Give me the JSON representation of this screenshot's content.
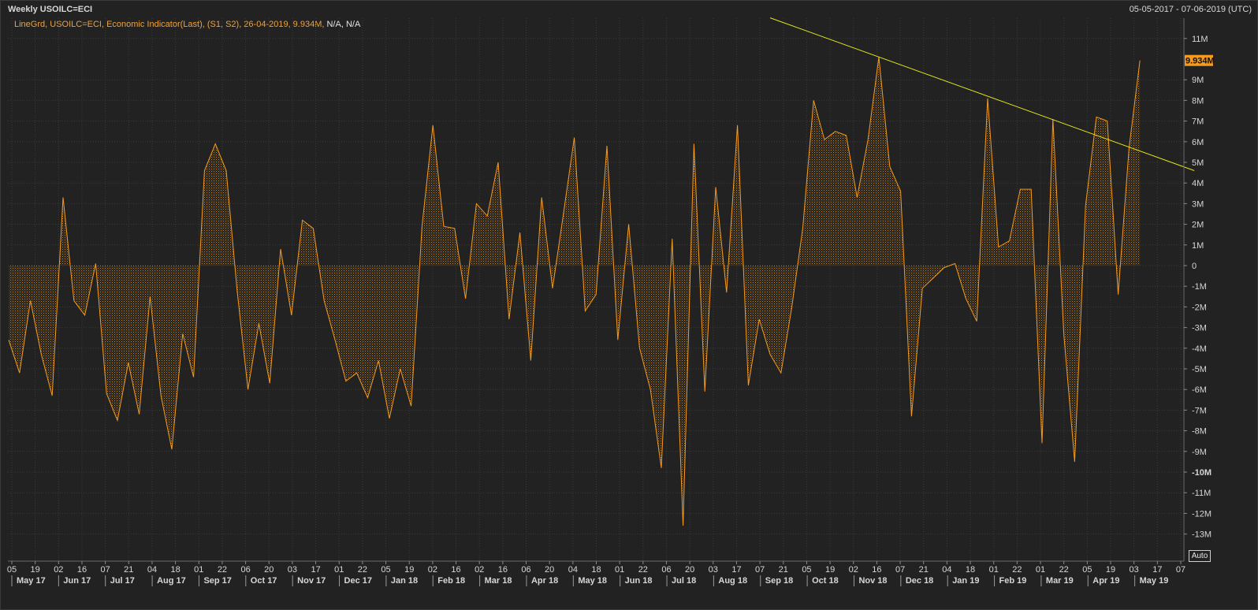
{
  "header": {
    "title": "Weekly USOILC=ECI",
    "date_range": "05-05-2017 - 07-06-2019 (UTC)"
  },
  "legend": {
    "text": "LineGrd, USOILC=ECI, Economic Indicator(Last), (S1, S2), 26-04-2019, 9.934M,",
    "na": "N/A, N/A"
  },
  "last_value_label": "9.934M",
  "auto_button": "Auto",
  "colors": {
    "background": "#222222",
    "series": "#f59a1d",
    "trendline": "#e4e81c",
    "grid": "#3a3a3a",
    "axis_text": "#d6d6d6",
    "last_value_bg": "#f59a1d"
  },
  "chart_data": {
    "type": "area",
    "series": [
      {
        "values": [
          -3.6,
          -5.2,
          -1.7,
          -4.3,
          -6.3,
          3.3,
          -1.7,
          -2.4,
          0.1,
          -6.2,
          -7.5,
          -4.7,
          -7.2,
          -1.5,
          -6.3,
          -8.9,
          -3.3,
          -5.4,
          4.6,
          5.9,
          4.6,
          -1.2,
          -6,
          -2.8,
          -5.7,
          0.8,
          -2.4,
          2.2,
          1.8,
          -1.7,
          -3.6,
          -5.6,
          -5.2,
          -6.4,
          -4.6,
          -7.4,
          -5,
          -6.8,
          1.9,
          6.8,
          1.9,
          1.8,
          -1.6,
          3,
          2.4,
          5,
          -2.6,
          1.6,
          -4.6,
          3.3,
          -1.1,
          2.5,
          6.2,
          -2.2,
          -1.4,
          5.8,
          -3.6,
          2,
          -4,
          -6,
          -9.8,
          1.3,
          -12.6,
          5.9,
          -6.1,
          3.8,
          -1.3,
          6.8,
          -5.8,
          -2.6,
          -4.3,
          -5.2,
          -2,
          1.8,
          8,
          6.1,
          6.5,
          6.3,
          3.3,
          6.1,
          10.1,
          4.8,
          3.6,
          -7.3,
          -1.1,
          -0.6,
          -0.1,
          0.1,
          -1.6,
          -2.7,
          8.1,
          0.9,
          1.2,
          3.7,
          3.7,
          -8.6,
          7.1,
          -3.3,
          -9.5,
          2.9,
          7.2,
          7.0,
          -1.4,
          5.7,
          9.934
        ]
      }
    ],
    "trendline": {
      "from": {
        "x": "2018-09-07",
        "y": 12.0
      },
      "to": {
        "x": "2019-06-07",
        "y": 4.6
      }
    },
    "ylim": [
      -14,
      12
    ],
    "yticks": [
      {
        "v": 11,
        "label": "11M",
        "bold": false
      },
      {
        "v": 9,
        "label": "9M",
        "bold": false
      },
      {
        "v": 8,
        "label": "8M",
        "bold": false
      },
      {
        "v": 7,
        "label": "7M",
        "bold": false
      },
      {
        "v": 6,
        "label": "6M",
        "bold": false
      },
      {
        "v": 5,
        "label": "5M",
        "bold": false
      },
      {
        "v": 4,
        "label": "4M",
        "bold": false
      },
      {
        "v": 3,
        "label": "3M",
        "bold": false
      },
      {
        "v": 2,
        "label": "2M",
        "bold": false
      },
      {
        "v": 1,
        "label": "1M",
        "bold": false
      },
      {
        "v": 0,
        "label": "0",
        "bold": false
      },
      {
        "v": -1,
        "label": "-1M",
        "bold": false
      },
      {
        "v": -2,
        "label": "-2M",
        "bold": false
      },
      {
        "v": -3,
        "label": "-3M",
        "bold": false
      },
      {
        "v": -4,
        "label": "-4M",
        "bold": false
      },
      {
        "v": -5,
        "label": "-5M",
        "bold": false
      },
      {
        "v": -6,
        "label": "-6M",
        "bold": false
      },
      {
        "v": -7,
        "label": "-7M",
        "bold": false
      },
      {
        "v": -8,
        "label": "-8M",
        "bold": false
      },
      {
        "v": -9,
        "label": "-9M",
        "bold": false
      },
      {
        "v": -10,
        "label": "-10M",
        "bold": true
      },
      {
        "v": -11,
        "label": "-11M",
        "bold": false
      },
      {
        "v": -12,
        "label": "-12M",
        "bold": false
      },
      {
        "v": -13,
        "label": "-13M",
        "bold": false
      }
    ],
    "xdays": [
      "05",
      "19",
      "02",
      "16",
      "07",
      "21",
      "04",
      "18",
      "01",
      "22",
      "06",
      "20",
      "03",
      "17",
      "01",
      "22",
      "05",
      "19",
      "02",
      "16",
      "02",
      "16",
      "06",
      "20",
      "04",
      "18",
      "01",
      "22",
      "06",
      "20",
      "03",
      "17",
      "07",
      "21",
      "05",
      "19",
      "02",
      "16",
      "07",
      "21",
      "04",
      "18",
      "01",
      "22",
      "01",
      "22",
      "05",
      "19",
      "03",
      "17",
      "07"
    ],
    "xmonths": [
      "May 17",
      "Jun 17",
      "Jul 17",
      "Aug 17",
      "Sep 17",
      "Oct 17",
      "Nov 17",
      "Dec 17",
      "Jan 18",
      "Feb 18",
      "Mar 18",
      "Apr 18",
      "May 18",
      "Jun 18",
      "Jul 18",
      "Aug 18",
      "Sep 18",
      "Oct 18",
      "Nov 18",
      "Dec 18",
      "Jan 19",
      "Feb 19",
      "Mar 19",
      "Apr 19",
      "May 19"
    ]
  }
}
